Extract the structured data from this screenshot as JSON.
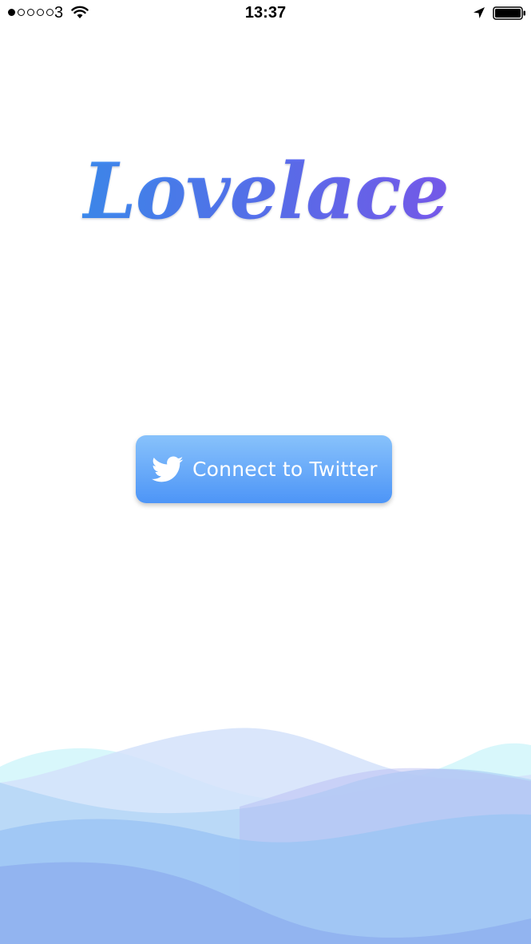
{
  "status_bar": {
    "signal_strength": 1,
    "signal_max": 5,
    "carrier": "3",
    "time": "13:37",
    "icons": [
      "wifi-icon",
      "location-arrow-icon",
      "battery-icon"
    ]
  },
  "app": {
    "logo_text": "Lovelace",
    "logo_gradient": [
      "#3f8ff3",
      "#7d5cf2"
    ]
  },
  "connect_button": {
    "label": "Connect to Twitter",
    "icon": "twitter-bird-icon",
    "color_top": "#88c2fb",
    "color_bottom": "#4d95f7"
  },
  "decoration": {
    "name": "waves",
    "colors": [
      "#d4f6fb",
      "#dce6fb",
      "#9ec5f4",
      "#8fb0ef"
    ]
  }
}
